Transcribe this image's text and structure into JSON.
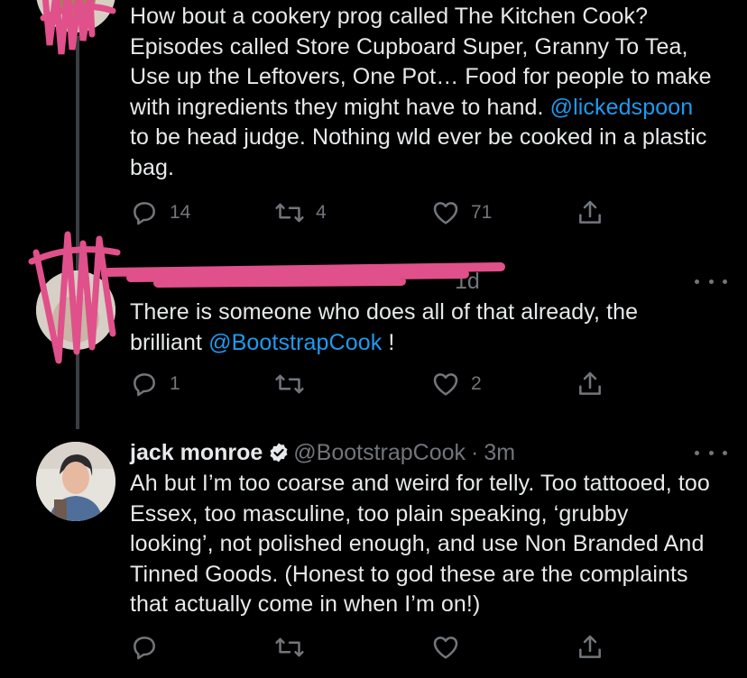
{
  "tweets": [
    {
      "text_parts": [
        "How bout a cookery prog called The Kitchen Cook? Episodes called Store Cupboard Super, Granny To Tea, Use up the Leftovers, One Pot… Food for people to make with ingredients they might have to hand. ",
        "@lickedspoon",
        " to be head judge. Nothing wld ever be cooked in a plastic bag."
      ],
      "reply_count": "14",
      "retweet_count": "4",
      "like_count": "71"
    },
    {
      "time": "1d",
      "text_parts": [
        "There is someone who does all of that already, the brilliant ",
        "@BootstrapCook",
        " !"
      ],
      "reply_count": "1",
      "retweet_count": "",
      "like_count": "2"
    },
    {
      "name": "jack monroe",
      "handle": "@BootstrapCook",
      "separator": "·",
      "time": "3m",
      "text": "Ah but I’m too coarse and weird for telly. Too tattooed, too Essex, too masculine, too plain speaking, ‘grubby looking’, not polished enough, and use Non Branded And Tinned Goods. (Honest to god these are the complaints that actually come in when I’m on!)",
      "reply_count": "",
      "retweet_count": "",
      "like_count": ""
    }
  ],
  "icons": {
    "reply": "reply-icon",
    "retweet": "retweet-icon",
    "like": "heart-icon",
    "share": "share-icon",
    "more": "more-options-icon",
    "verified": "verified-badge-icon"
  },
  "colors": {
    "background": "#000000",
    "text": "#e7e9ea",
    "muted": "#71767b",
    "link": "#1d9bf0",
    "redaction": "#e0508a"
  }
}
